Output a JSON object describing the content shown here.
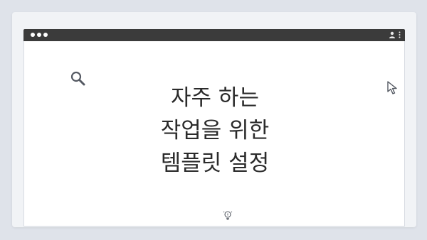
{
  "slide": {
    "headline_lines": [
      "자주 하는",
      "작업을 위한",
      "템플릿 설정"
    ]
  },
  "icons": {
    "search": "search-icon",
    "cursor": "cursor-arrow-icon",
    "lightbulb": "lightbulb-icon",
    "user": "user-icon",
    "menu": "kebab-menu-icon"
  },
  "colors": {
    "background": "#dfe3ea",
    "titlebar": "#3b3b3b",
    "content": "#ffffff",
    "text": "#2b2b2b",
    "icon_stroke": "#555a63"
  }
}
